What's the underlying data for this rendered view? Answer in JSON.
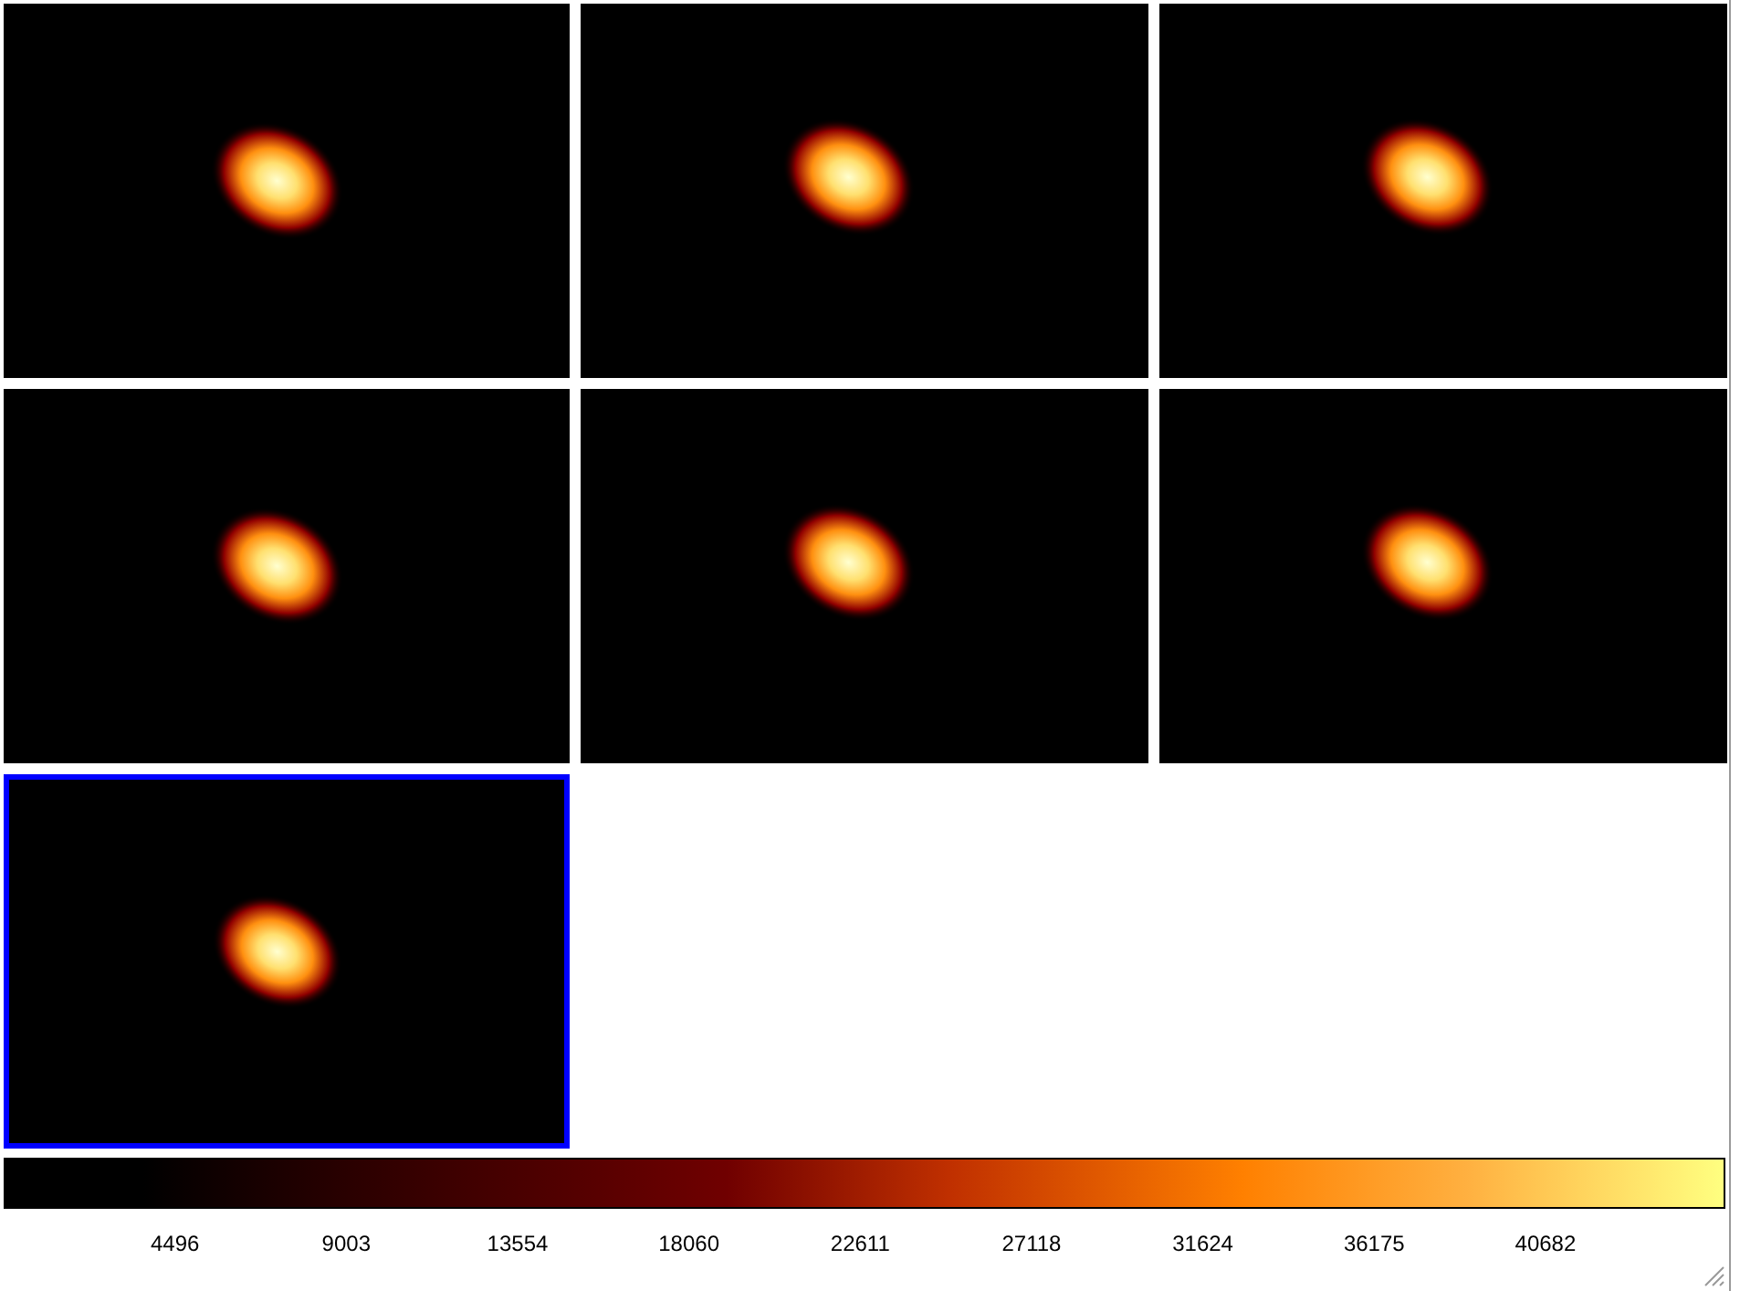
{
  "frames": [
    {
      "kind": "picture",
      "selected": false
    },
    {
      "kind": "picture",
      "selected": false
    },
    {
      "kind": "picture",
      "selected": false
    },
    {
      "kind": "picture",
      "selected": false
    },
    {
      "kind": "picture",
      "selected": false
    },
    {
      "kind": "picture",
      "selected": false
    },
    {
      "kind": "picture",
      "selected": true
    }
  ],
  "colorbar": {
    "ticks": [
      "4496",
      "9003",
      "13554",
      "18060",
      "22611",
      "27118",
      "31624",
      "36175",
      "40682"
    ]
  }
}
